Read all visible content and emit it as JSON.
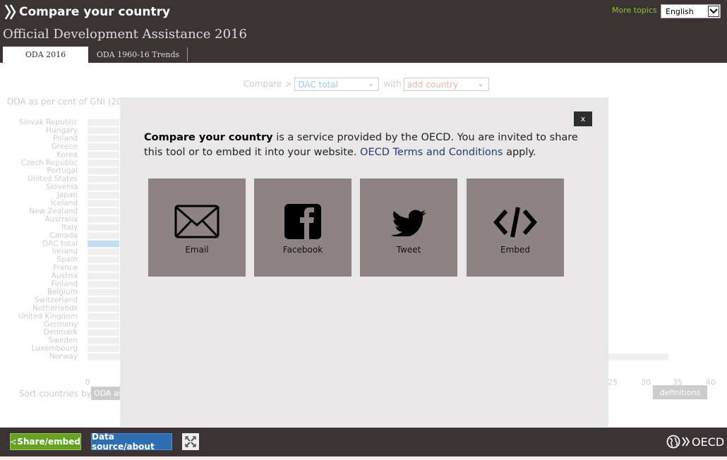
{
  "header": {
    "app_title": "Compare your country",
    "more_topics": "More topics",
    "language": "English",
    "page_title": "Official Development Assistance 2016"
  },
  "tabs": [
    {
      "label": "ODA 2016",
      "active": true
    },
    {
      "label": "ODA 1960-16 Trends",
      "active": false
    }
  ],
  "compare": {
    "label": "Compare >",
    "selected": "DAC total",
    "with_label": "with",
    "add_placeholder": "add country"
  },
  "chart_data": {
    "type": "bar",
    "title": "ODA as per cent of GNI (20",
    "categories": [
      "Slovak Republic",
      "Hungary",
      "Poland",
      "Greece",
      "Korea",
      "Czech Republic",
      "Portugal",
      "United States",
      "Slovenia",
      "Japan",
      "Iceland",
      "New Zealand",
      "Australia",
      "Italy",
      "Canada",
      "DAC total",
      "Ireland",
      "Spain",
      "France",
      "Austria",
      "Finland",
      "Belgium",
      "Switzerland",
      "Netherlands",
      "United Kingdom",
      "Germany",
      "Denmark",
      "Sweden",
      "Luxembourg",
      "Norway"
    ],
    "highlight": "DAC total",
    "x_ticks": [
      "0",
      "25",
      "30",
      "35",
      "40"
    ],
    "xlim": [
      0,
      40
    ]
  },
  "sort": {
    "label": "Sort countries by",
    "value": "ODA as"
  },
  "definitions_label": "definitions",
  "modal": {
    "close_label": "x",
    "brand": "Compare your country",
    "text": " is a service provided by the OECD. You are invited to share this tool or to embed it into your website. ",
    "link": "OECD Terms and Conditions",
    "text_end": " apply.",
    "tiles": {
      "email": "Email",
      "facebook": "Facebook",
      "tweet": "Tweet",
      "embed": "Embed"
    }
  },
  "footer": {
    "share": "Share/embed",
    "datasource": "Data source/about",
    "oecd": "OECD"
  },
  "colors": {
    "header_bg": "#3c3434",
    "share_green": "#67a227",
    "datasource_blue": "#2e6fb4",
    "tile_gray": "#8d8383",
    "highlight_blue": "#c4dcf0"
  }
}
